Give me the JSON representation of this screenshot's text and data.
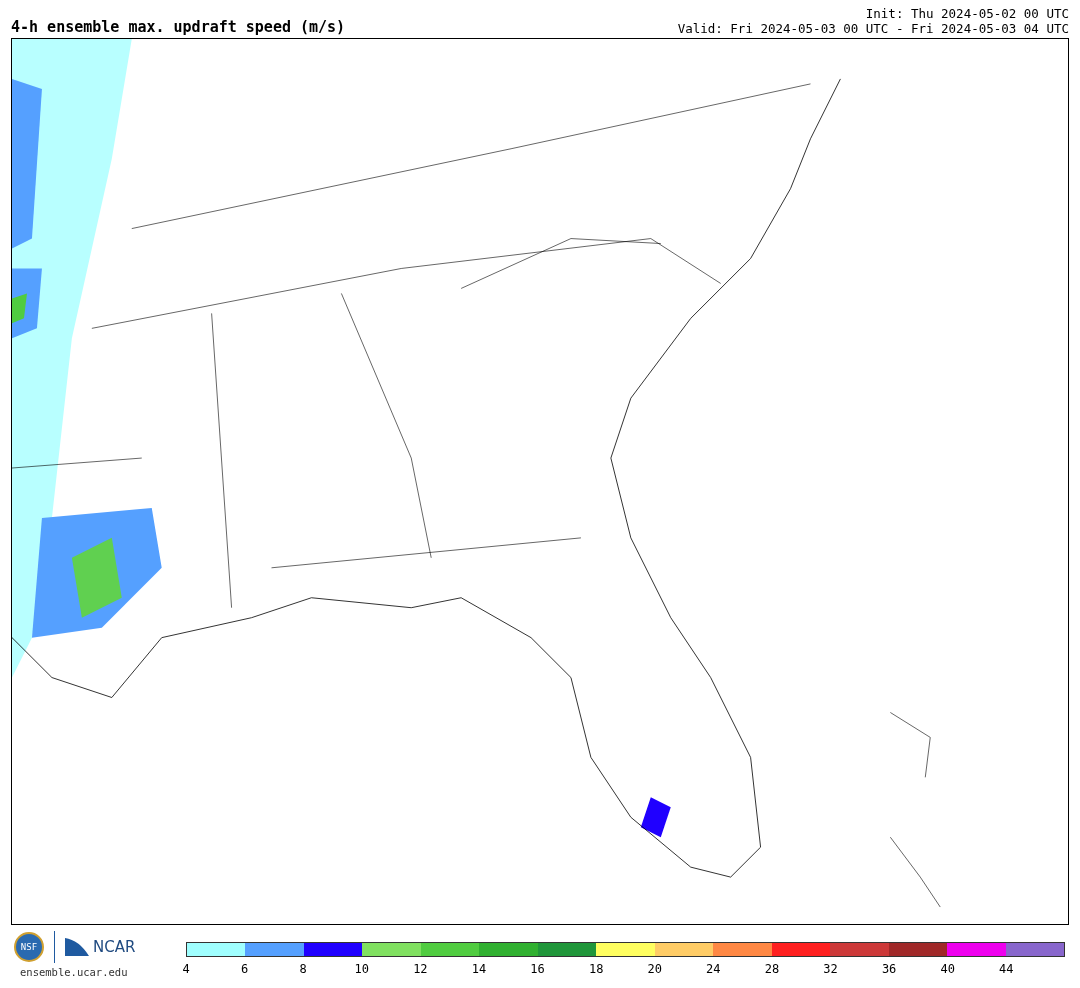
{
  "title": "4-h ensemble max. updraft speed (m/s)",
  "init": "Init: Thu 2024-05-02 00 UTC",
  "valid": "Valid: Fri 2024-05-03 00 UTC - Fri 2024-05-03 04 UTC",
  "logos": {
    "nsf": "NSF",
    "ncar": "NCAR",
    "url": "ensemble.ucar.edu"
  },
  "legend": [
    {
      "color": "#a0ffff",
      "label": "4"
    },
    {
      "color": "#55a0ff",
      "label": "6"
    },
    {
      "color": "#2000ff",
      "label": "8"
    },
    {
      "color": "#80e060",
      "label": "10"
    },
    {
      "color": "#50cc40",
      "label": "12"
    },
    {
      "color": "#30b030",
      "label": "14"
    },
    {
      "color": "#20963a",
      "label": "16"
    },
    {
      "color": "#ffff60",
      "label": "18"
    },
    {
      "color": "#ffcc66",
      "label": "20"
    },
    {
      "color": "#ff8844",
      "label": "24"
    },
    {
      "color": "#ff2020",
      "label": "28"
    },
    {
      "color": "#cc3838",
      "label": "32"
    },
    {
      "color": "#a02828",
      "label": "36"
    },
    {
      "color": "#ee00ee",
      "label": "40"
    },
    {
      "color": "#8866cc",
      "label": "44"
    }
  ]
}
